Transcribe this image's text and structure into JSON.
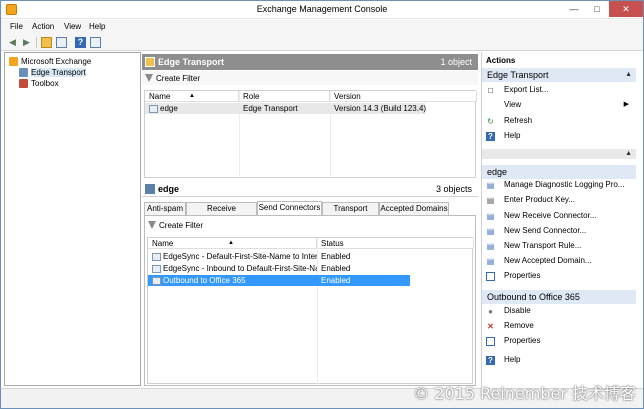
{
  "window": {
    "title": "Exchange Management Console"
  },
  "menu": [
    "File",
    "Action",
    "View",
    "Help"
  ],
  "tree": {
    "items": [
      "Microsoft Exchange",
      "Edge Transport",
      "Toolbox"
    ]
  },
  "top_pane": {
    "title": "Edge Transport",
    "count": "1 object",
    "create_filter": "Create Filter",
    "columns": [
      "Name",
      "Role",
      "Version"
    ],
    "rows": [
      {
        "name": "edge",
        "role": "Edge Transport",
        "version": "Version 14.3 (Build 123.4)"
      }
    ]
  },
  "bottom_pane": {
    "title": "edge",
    "count": "3 objects",
    "tabs": [
      "Anti-spam",
      "Receive Connectors",
      "Send Connectors",
      "Transport Rules",
      "Accepted Domains"
    ],
    "active_tab": "Send Connectors",
    "create_filter": "Create Filter",
    "columns": [
      "Name",
      "Status"
    ],
    "rows": [
      {
        "name": "EdgeSync - Default-First-Site-Name to Internet",
        "status": "Enabled"
      },
      {
        "name": "EdgeSync - Inbound to Default-First-Site-Name",
        "status": "Enabled"
      },
      {
        "name": "Outbound to Office 365",
        "status": "Enabled"
      }
    ]
  },
  "actions": {
    "header": "Actions",
    "section1": {
      "title": "Edge Transport",
      "items": [
        "Export List...",
        "View",
        "Refresh",
        "Help"
      ]
    },
    "section2": {
      "title": "edge",
      "items": [
        "Manage Diagnostic Logging Pro...",
        "Enter Product Key...",
        "New Receive Connector...",
        "New Send Connector...",
        "New Transport Rule...",
        "New Accepted Domain...",
        "Properties"
      ]
    },
    "section3": {
      "title": "Outbound to Office 365",
      "items": [
        "Disable",
        "Remove",
        "Properties"
      ]
    },
    "help": "Help"
  },
  "watermark": "© 2015 Reinember 技术博客",
  "colors": {
    "selection": "#3399ff",
    "section_bg": "#dfe9f5",
    "pane_header": "#8e8e8e"
  }
}
